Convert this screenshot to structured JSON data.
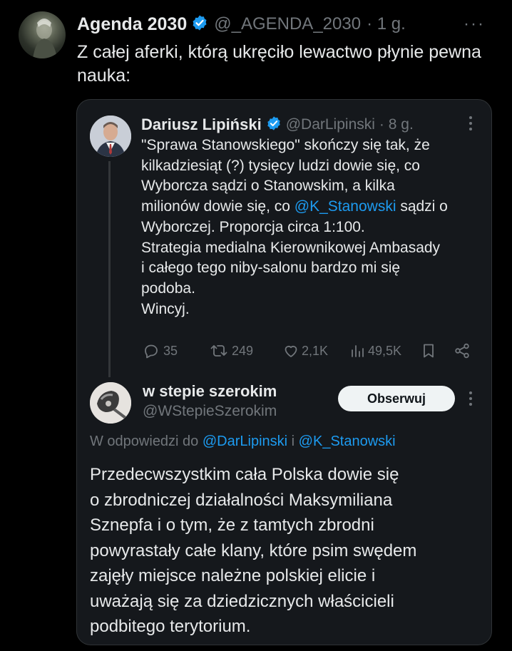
{
  "outer_tweet": {
    "name": "Agenda 2030",
    "handle": "@_AGENDA_2030",
    "time": "· 1 g.",
    "more": "···",
    "text": "Z całej aferki, którą ukręciło lewactwo płynie pewna nauka:"
  },
  "quoted_tweet": {
    "name": "Dariusz Lipiński",
    "handle": "@DarLipinski",
    "time": "· 8 g.",
    "text_lines": [
      "\"Sprawa Stanowskiego\" skończy się tak, że",
      "kilkadziesiąt (?) tysięcy ludzi dowie się, co",
      "Wyborcza sądzi o Stanowskim, a kilka"
    ],
    "mention_line_prefix": "milionów dowie się, co ",
    "mention": "@K_Stanowski",
    "mention_line_suffix": " sądzi o",
    "text_lines_after": [
      "Wyborczej. Proporcja circa 1:100.",
      "Strategia medialna Kierownikowej Ambasady",
      "i całego tego niby-salonu bardzo mi się",
      "podoba.",
      "Wincyj."
    ],
    "stats": {
      "replies": "35",
      "reposts": "249",
      "likes": "2,1K",
      "views": "49,5K"
    }
  },
  "reply_tweet": {
    "name": "w stepie szerokim",
    "handle": "@WStepieSzerokim",
    "follow_label": "Obserwuj",
    "in_reply_prefix": "W odpowiedzi do ",
    "in_reply_user1": "@DarLipinski",
    "in_reply_and": " i ",
    "in_reply_user2": "@K_Stanowski",
    "text_lines": [
      "Przedecwszystkim cała Polska dowie się",
      "o zbrodniczej działalności Maksymiliana",
      "Sznepfa i o tym, że z tamtych zbrodni",
      "powyrastały całe klany, które psim swędem",
      "zajęły miejsce należne polskiej elicie i",
      "uważają się za dziedzicznych właścicieli",
      "podbitego terytorium."
    ]
  },
  "colors": {
    "background": "#000000",
    "card": "#15181c",
    "text": "#e7e9ea",
    "muted": "#71767b",
    "link": "#1d9bf0",
    "verified": "#1d9bf0"
  }
}
